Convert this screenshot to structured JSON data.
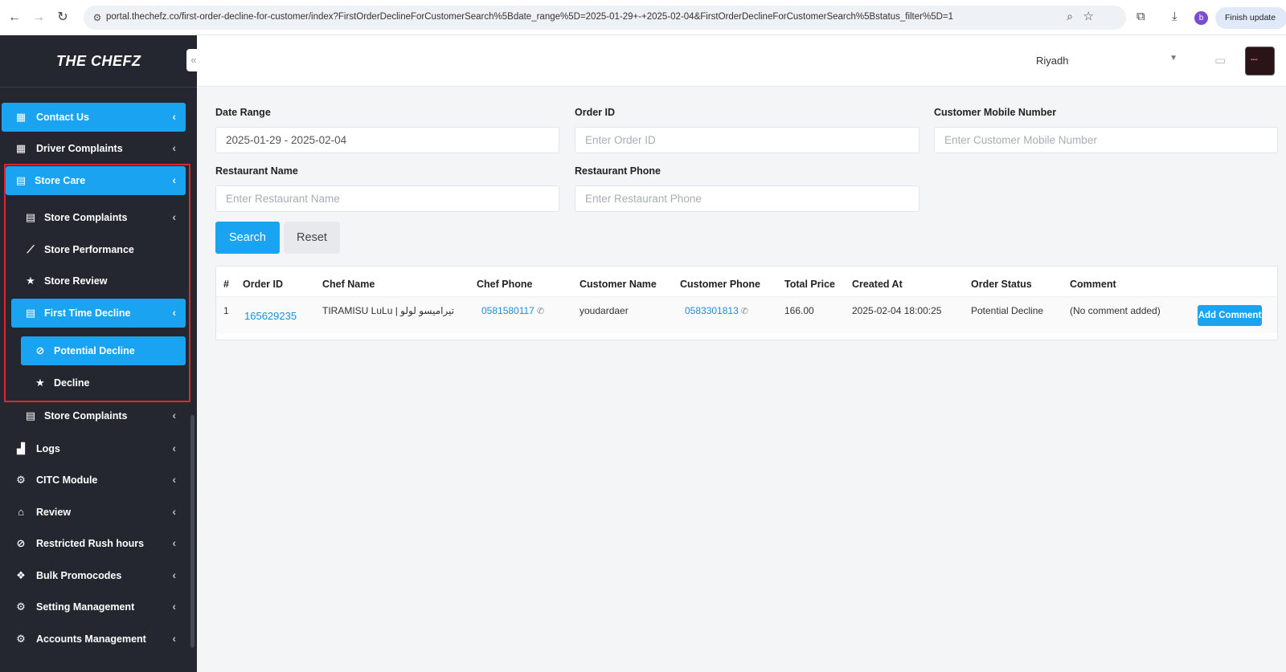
{
  "browser": {
    "url": "portal.thechefz.co/first-order-decline-for-customer/index?FirstOrderDeclineForCustomerSearch%5Bdate_range%5D=2025-01-29+-+2025-02-04&FirstOrderDeclineForCustomerSearch%5Bstatus_filter%5D=1",
    "profile_initial": "b",
    "finish_update_label": "Finish update"
  },
  "brand": {
    "name": "THE CHEFZ"
  },
  "sidebar": {
    "items": [
      {
        "label": "Contact Us",
        "icon": "building-icon"
      },
      {
        "label": "Driver Complaints",
        "icon": "building-icon"
      },
      {
        "label": "Store Care",
        "icon": "store-icon"
      },
      {
        "label": "Store Complaints",
        "icon": "store-icon"
      },
      {
        "label": "Store Performance",
        "icon": "chart-line-icon"
      },
      {
        "label": "Store Review",
        "icon": "star-icon"
      },
      {
        "label": "First Time Decline",
        "icon": "store-icon"
      },
      {
        "label": "Potential Decline",
        "icon": "ban-icon"
      },
      {
        "label": "Decline",
        "icon": "star-icon"
      },
      {
        "label": "Store Complaints",
        "icon": "store-icon"
      },
      {
        "label": "Logs",
        "icon": "chart-area-icon"
      },
      {
        "label": "CITC Module",
        "icon": "cogs-icon"
      },
      {
        "label": "Review",
        "icon": "bank-icon"
      },
      {
        "label": "Restricted Rush hours",
        "icon": "ban-icon"
      },
      {
        "label": "Bulk Promocodes",
        "icon": "cubes-icon"
      },
      {
        "label": "Setting Management",
        "icon": "cogs-icon"
      },
      {
        "label": "Accounts Management",
        "icon": "cogs-icon"
      }
    ]
  },
  "topbar": {
    "city": "Riyadh"
  },
  "filters": {
    "date_range_label": "Date Range",
    "date_range_value": "2025-01-29 - 2025-02-04",
    "order_id_label": "Order ID",
    "order_id_placeholder": "Enter Order ID",
    "mobile_label": "Customer Mobile Number",
    "mobile_placeholder": "Enter Customer Mobile Number",
    "restaurant_name_label": "Restaurant Name",
    "restaurant_name_placeholder": "Enter Restaurant Name",
    "restaurant_phone_label": "Restaurant Phone",
    "restaurant_phone_placeholder": "Enter Restaurant Phone",
    "search_label": "Search",
    "reset_label": "Reset"
  },
  "table": {
    "headers": [
      "#",
      "Order ID",
      "Chef Name",
      "Chef Phone",
      "Customer Name",
      "Customer Phone",
      "Total Price",
      "Created At",
      "Order Status",
      "Comment"
    ],
    "rows": [
      {
        "index": "1",
        "order_id": "165629235",
        "chef_name": "TIRAMISU LuLu | تيراميسو لولو",
        "chef_phone": "0581580117",
        "customer_name": "youdardaer",
        "customer_phone": "0583301813",
        "total_price": "166.00",
        "created_at": "2025-02-04 18:00:25",
        "order_status": "Potential Decline",
        "comment": "(No comment added)",
        "action_label": "Add Comment"
      }
    ]
  }
}
